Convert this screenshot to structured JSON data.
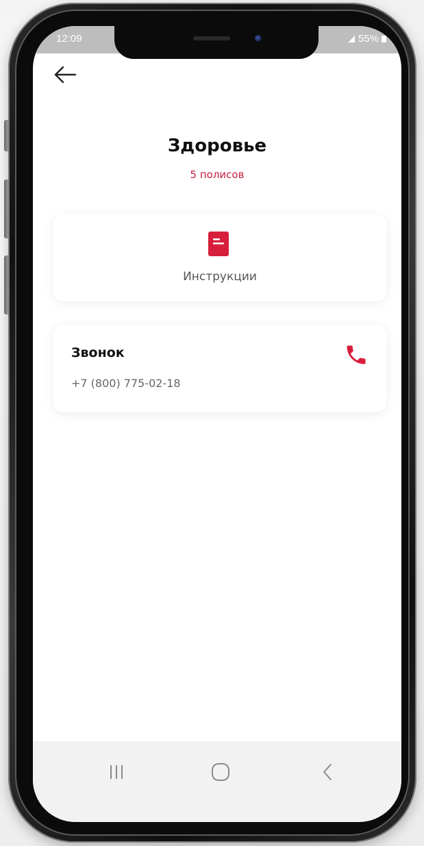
{
  "status_bar": {
    "time": "12:09",
    "battery": "55%"
  },
  "header": {
    "back_icon": "arrow-left-icon",
    "title": "Здоровье",
    "subtitle": "5 полисов"
  },
  "cards": {
    "instructions": {
      "icon": "document-icon",
      "label": "Инструкции"
    },
    "call": {
      "title": "Звонок",
      "number": "+7 (800) 775-02-18",
      "icon": "phone-icon"
    }
  },
  "nav_bar": {
    "recents_icon": "recents-icon",
    "home_icon": "home-icon",
    "back_icon": "chevron-left-icon"
  },
  "colors": {
    "accent": "#d81e3d",
    "screen_bg": "#ffffff",
    "nav_bg": "#f2f2f2"
  }
}
